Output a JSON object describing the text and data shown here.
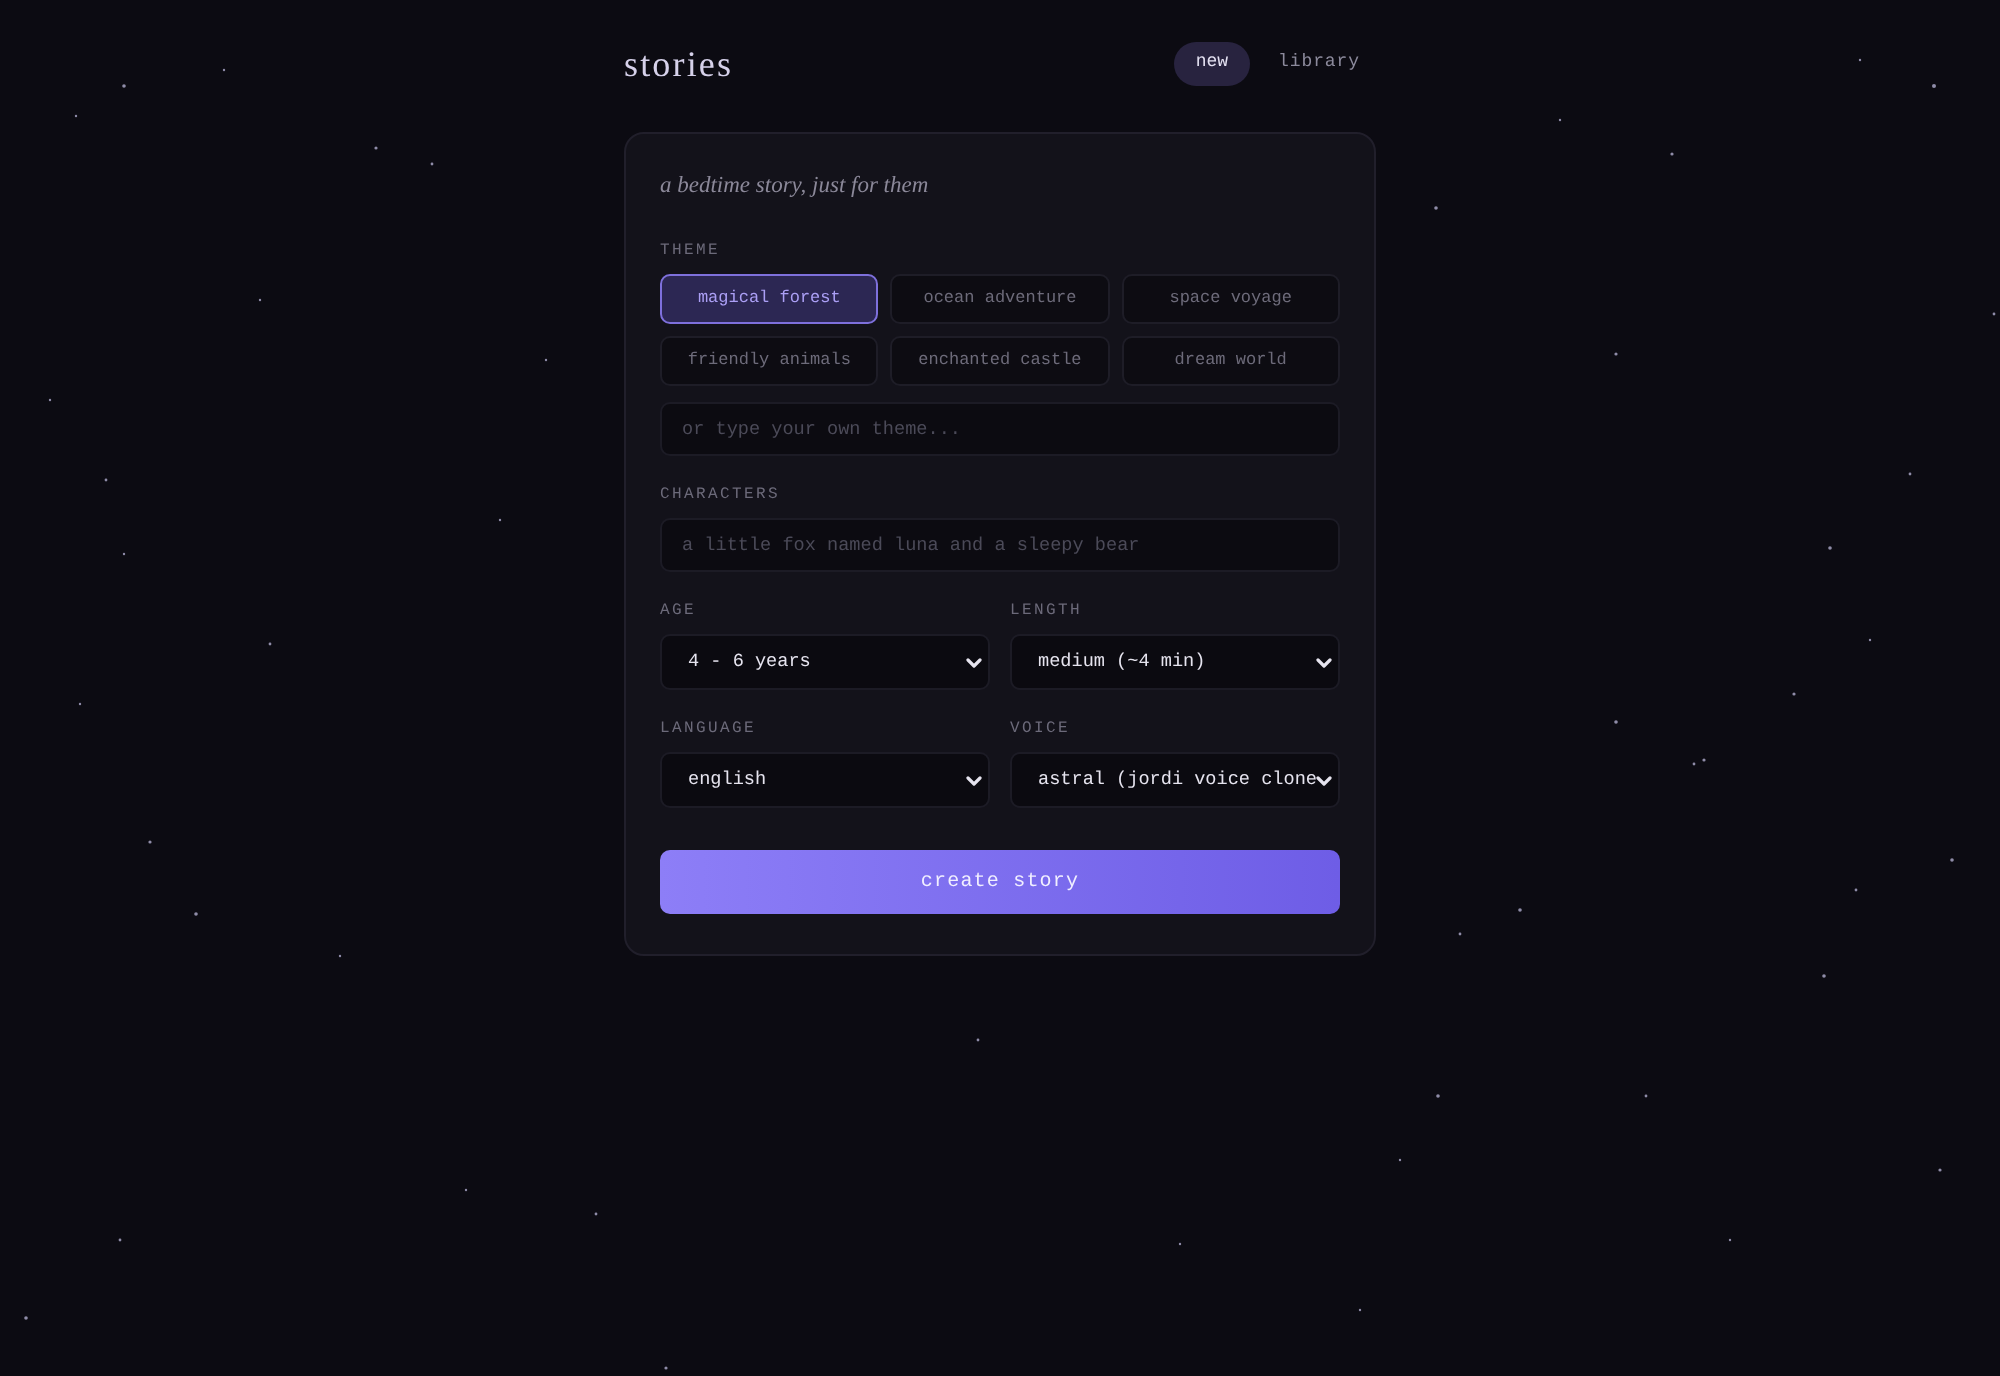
{
  "header": {
    "title": "stories",
    "nav": [
      {
        "label": "new",
        "selected": true
      },
      {
        "label": "library",
        "selected": false
      }
    ]
  },
  "form": {
    "subtitle": "a bedtime story, just for them",
    "theme": {
      "label": "THEME",
      "options": [
        {
          "label": "magical forest",
          "selected": true
        },
        {
          "label": "ocean adventure",
          "selected": false
        },
        {
          "label": "space voyage",
          "selected": false
        },
        {
          "label": "friendly animals",
          "selected": false
        },
        {
          "label": "enchanted castle",
          "selected": false
        },
        {
          "label": "dream world",
          "selected": false
        }
      ],
      "custom": {
        "placeholder": "or type your own theme..."
      }
    },
    "characters": {
      "label": "CHARACTERS",
      "placeholder": "a little fox named luna and a sleepy bear"
    },
    "selects": [
      {
        "label": "AGE",
        "value": "4 - 6 years"
      },
      {
        "label": "LENGTH",
        "value": "medium (~4 min)"
      },
      {
        "label": "LANGUAGE",
        "value": "english"
      },
      {
        "label": "VOICE",
        "value": "astral (jordi voice clone"
      }
    ],
    "submit": "create story"
  }
}
